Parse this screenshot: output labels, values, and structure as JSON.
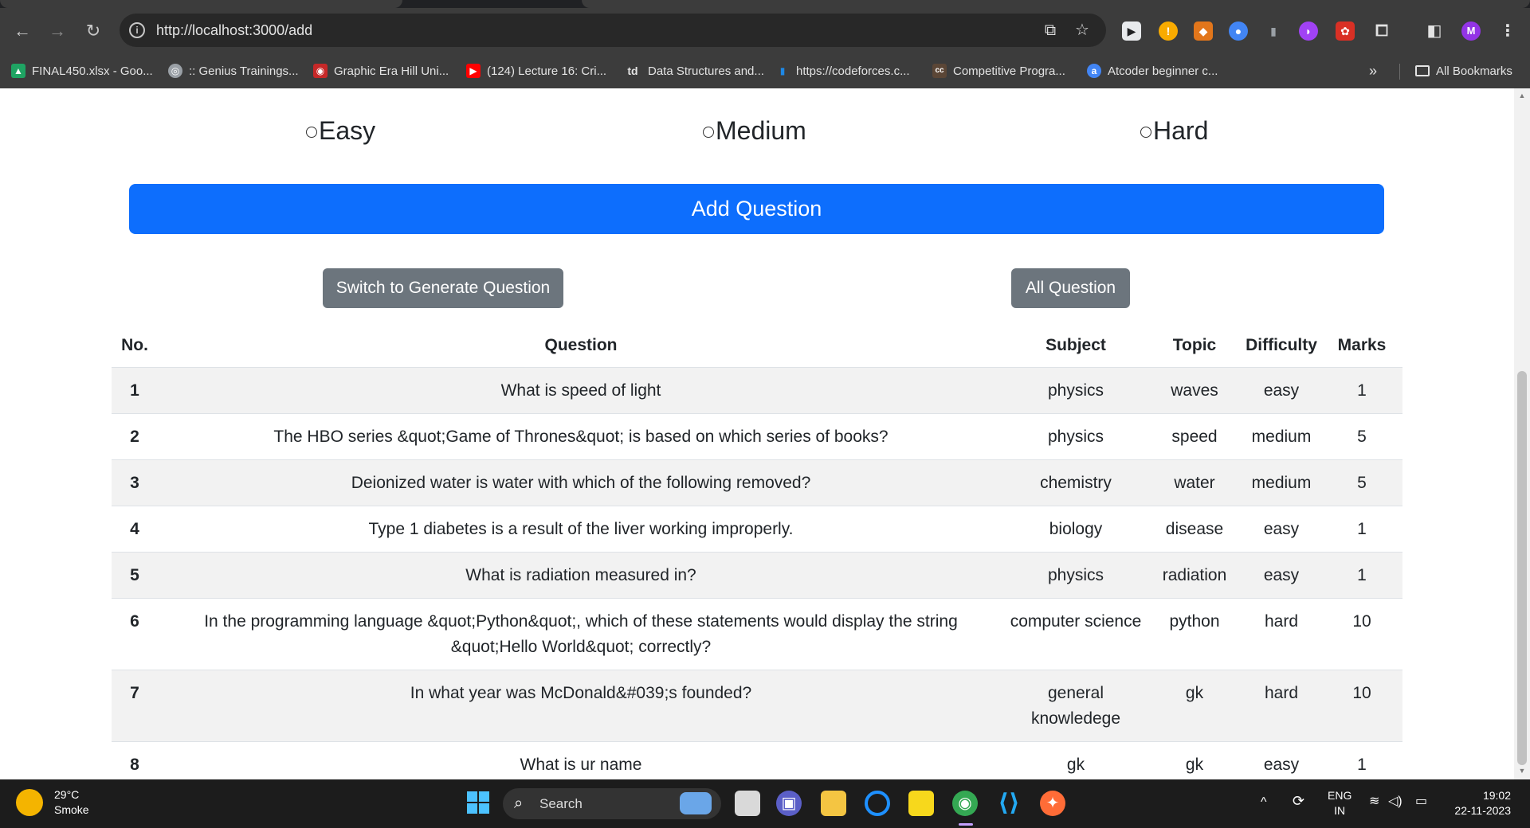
{
  "browser": {
    "url": "http://localhost:3000/add",
    "bookmarks": [
      {
        "label": "FINAL450.xlsx - Goo...",
        "icon": "drive-icon",
        "color": "#1fa463"
      },
      {
        "label": ":: Genius Trainings...",
        "icon": "globe-icon",
        "color": "#9aa0a6"
      },
      {
        "label": "Graphic Era Hill Uni...",
        "icon": "university-icon",
        "color": "#c62828"
      },
      {
        "label": "(124) Lecture 16: Cri...",
        "icon": "youtube-icon",
        "color": "#ff0000"
      },
      {
        "label": "Data Structures and...",
        "icon": "td-icon",
        "color": "#3c3c3c"
      },
      {
        "label": "https://codeforces.c...",
        "icon": "codeforces-icon",
        "color": "#1e88e5"
      },
      {
        "label": "Competitive Progra...",
        "icon": "codechef-icon",
        "color": "#5b4636"
      },
      {
        "label": "Atcoder beginner c...",
        "icon": "atcoder-icon",
        "color": "#4285f4"
      }
    ],
    "all_bookmarks": "All Bookmarks",
    "profile_initial": "M"
  },
  "form": {
    "difficulty_options": [
      "Easy",
      "Medium",
      "Hard"
    ],
    "add_button": "Add Question",
    "switch_button": "Switch to Generate Question",
    "all_button": "All Question"
  },
  "table": {
    "headers": [
      "No.",
      "Question",
      "Subject",
      "Topic",
      "Difficulty",
      "Marks"
    ],
    "rows": [
      {
        "no": "1",
        "question": "What is speed of light",
        "subject": "physics",
        "topic": "waves",
        "difficulty": "easy",
        "marks": "1"
      },
      {
        "no": "2",
        "question": "The HBO series &quot;Game of Thrones&quot; is based on which series of books?",
        "subject": "physics",
        "topic": "speed",
        "difficulty": "medium",
        "marks": "5"
      },
      {
        "no": "3",
        "question": "Deionized water is water with which of the following removed?",
        "subject": "chemistry",
        "topic": "water",
        "difficulty": "medium",
        "marks": "5"
      },
      {
        "no": "4",
        "question": "Type 1 diabetes is a result of the liver working improperly.",
        "subject": "biology",
        "topic": "disease",
        "difficulty": "easy",
        "marks": "1"
      },
      {
        "no": "5",
        "question": "What is radiation measured in?",
        "subject": "physics",
        "topic": "radiation",
        "difficulty": "easy",
        "marks": "1"
      },
      {
        "no": "6",
        "question": "In the programming language &quot;Python&quot;, which of these statements would display the string &quot;Hello World&quot; correctly?",
        "subject": "computer science",
        "topic": "python",
        "difficulty": "hard",
        "marks": "10"
      },
      {
        "no": "7",
        "question": "In what year was McDonald&#039;s founded?",
        "subject": "general knowledege",
        "topic": "gk",
        "difficulty": "hard",
        "marks": "10"
      },
      {
        "no": "8",
        "question": "What is ur name",
        "subject": "gk",
        "topic": "gk",
        "difficulty": "easy",
        "marks": "1"
      }
    ]
  },
  "taskbar": {
    "weather_temp": "29°C",
    "weather_desc": "Smoke",
    "search_label": "Search",
    "lang": "ENG",
    "region": "IN",
    "time": "19:02",
    "date": "22-11-2023"
  },
  "colors": {
    "primary": "#0d6efd",
    "secondary": "#6c757d",
    "striped_row": "#f2f2f2"
  }
}
